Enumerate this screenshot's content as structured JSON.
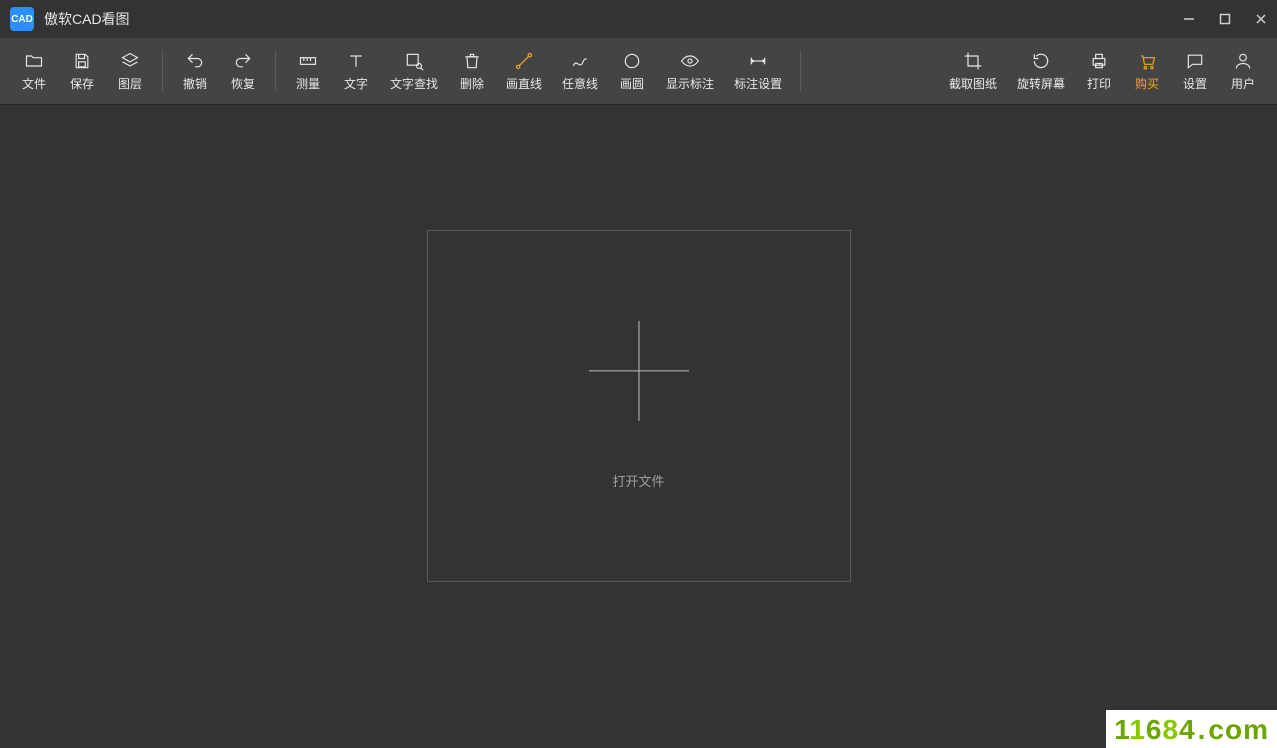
{
  "app": {
    "title": "傲软CAD看图",
    "icon_text": "CAD"
  },
  "window_controls": {
    "minimize": "—",
    "maximize": "□",
    "close": "×"
  },
  "toolbar": {
    "file": "文件",
    "save": "保存",
    "layers": "图层",
    "undo": "撤销",
    "redo": "恢复",
    "measure": "测量",
    "text": "文字",
    "text_find": "文字查找",
    "delete": "删除",
    "line": "画直线",
    "polyline": "任意线",
    "circle": "画圆",
    "show_annotation": "显示标注",
    "annotation_settings": "标注设置",
    "screenshot": "截取图纸",
    "rotate_screen": "旋转屏幕",
    "print": "打印",
    "buy": "购买",
    "settings": "设置",
    "user": "用户"
  },
  "dropzone": {
    "open_label": "打开文件"
  },
  "watermark": {
    "digits": "11684",
    "suffix": ".com"
  }
}
